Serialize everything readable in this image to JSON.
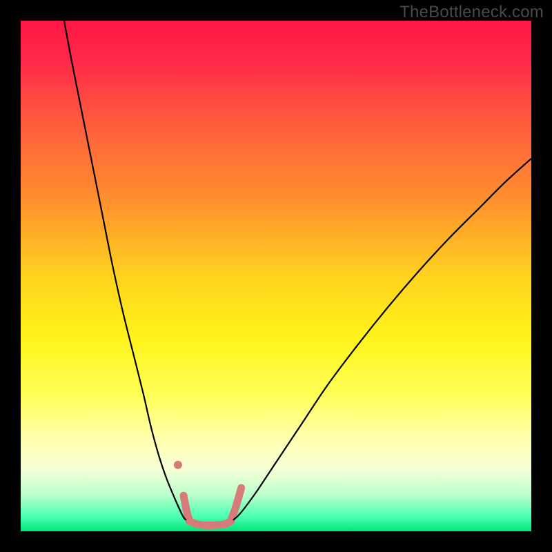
{
  "watermark": "TheBottleneck.com",
  "chart_data": {
    "type": "line",
    "title": "",
    "xlabel": "",
    "ylabel": "",
    "xlim": [
      0,
      100
    ],
    "ylim": [
      0,
      100
    ],
    "background_gradient_stops": [
      {
        "offset": 0.0,
        "color": "#ff1744"
      },
      {
        "offset": 0.08,
        "color": "#ff2a4a"
      },
      {
        "offset": 0.2,
        "color": "#ff5c3d"
      },
      {
        "offset": 0.35,
        "color": "#ff8f2e"
      },
      {
        "offset": 0.5,
        "color": "#ffd21f"
      },
      {
        "offset": 0.62,
        "color": "#fff31a"
      },
      {
        "offset": 0.73,
        "color": "#ffff55"
      },
      {
        "offset": 0.82,
        "color": "#ffffb0"
      },
      {
        "offset": 0.88,
        "color": "#f4ffd6"
      },
      {
        "offset": 0.93,
        "color": "#b8ffca"
      },
      {
        "offset": 0.97,
        "color": "#4dffb3"
      },
      {
        "offset": 1.0,
        "color": "#00e676"
      }
    ],
    "series": [
      {
        "name": "left_arm",
        "color": "#000000",
        "width": 2.2,
        "x": [
          8.5,
          10,
          12,
          14,
          16,
          18,
          20,
          22,
          24,
          25.5,
          27,
          28.5,
          29.8,
          30.8,
          31.5,
          32.0,
          32.4
        ],
        "y": [
          100,
          92,
          82,
          72,
          62,
          52,
          43,
          35,
          27,
          20.5,
          15,
          10.5,
          7.3,
          5.0,
          3.5,
          2.6,
          2.2
        ]
      },
      {
        "name": "right_arm",
        "color": "#000000",
        "width": 2.2,
        "x": [
          41.6,
          43,
          46,
          50,
          55,
          60,
          66,
          72,
          78,
          84,
          90,
          95,
          100
        ],
        "y": [
          2.2,
          3.5,
          7.5,
          13.5,
          21,
          28.5,
          36.5,
          44,
          51,
          57.5,
          63.5,
          68.5,
          73
        ]
      },
      {
        "name": "valley_floor",
        "color": "#d77a7a",
        "width": 11,
        "cap": "round",
        "x": [
          33.0,
          34.5,
          36.0,
          38.0,
          40.0,
          41.2
        ],
        "y": [
          2.0,
          1.4,
          1.2,
          1.2,
          1.4,
          2.0
        ]
      },
      {
        "name": "valley_left_wall",
        "color": "#d77a7a",
        "width": 11,
        "cap": "round",
        "x": [
          31.9,
          32.5,
          33.0
        ],
        "y": [
          7.0,
          4.0,
          2.2
        ]
      },
      {
        "name": "valley_right_wall",
        "color": "#d77a7a",
        "width": 11,
        "cap": "round",
        "x": [
          41.2,
          42.2,
          43.2
        ],
        "y": [
          2.2,
          5.0,
          8.5
        ]
      }
    ],
    "markers": [
      {
        "name": "dot_left",
        "x": 30.8,
        "y": 13.0,
        "r": 6,
        "color": "#d77a7a"
      }
    ]
  }
}
